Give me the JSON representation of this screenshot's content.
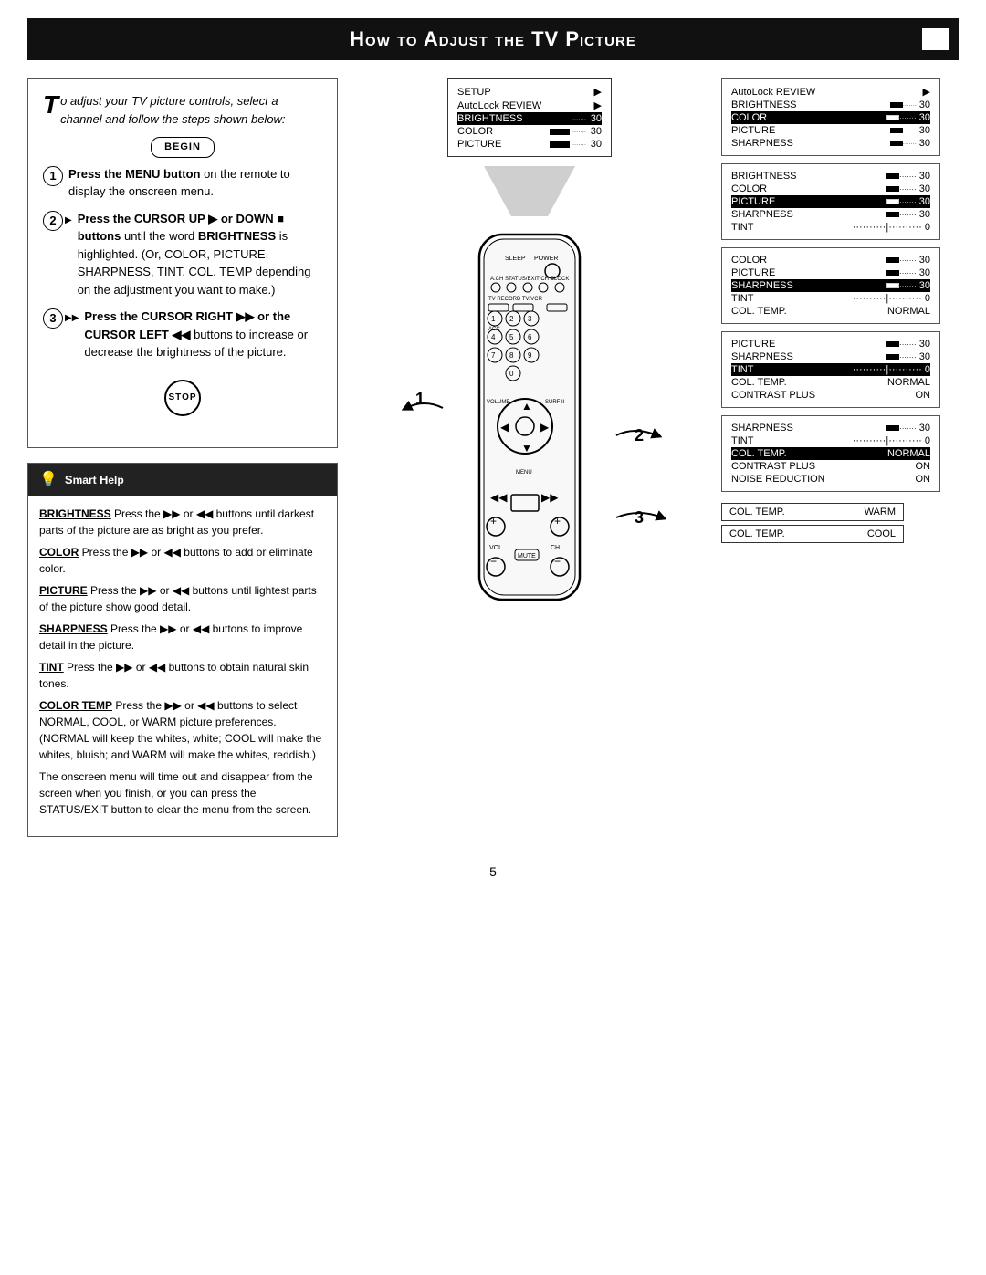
{
  "title": "How to Adjust the TV Picture",
  "intro": {
    "drop_cap": "T",
    "text": "o adjust your TV picture controls, select a channel and follow the steps shown below:"
  },
  "begin_label": "BEGIN",
  "stop_label": "STOP",
  "steps": [
    {
      "num": "1",
      "text_bold": "Press the MENU button",
      "text": " on the remote to display the onscreen menu."
    },
    {
      "num": "2",
      "text_bold": "Press the CURSOR UP ▶ or DOWN ■ buttons",
      "text": " until the word BRIGHTNESS is highlighted. (Or, COLOR, PICTURE, SHARPNESS, TINT, COL. TEMP depending on the adjustment you want to make.)"
    },
    {
      "num": "3",
      "text_bold": "Press the CURSOR RIGHT ▶▶ or the CURSOR LEFT ◀◀",
      "text": " buttons to increase or decrease the brightness of the picture."
    }
  ],
  "smart_help": {
    "title": "Smart Help",
    "items": [
      {
        "label": "BRIGHTNESS",
        "text": " Press the ▶▶ or ◀◀ buttons until darkest parts of the picture are as bright as you prefer."
      },
      {
        "label": "COLOR",
        "text": " Press the ▶▶ or ◀◀ buttons to add or eliminate color."
      },
      {
        "label": "PICTURE",
        "text": " Press the ▶▶ or ◀◀ buttons until lightest parts of the picture show good detail."
      },
      {
        "label": "SHARPNESS",
        "text": " Press the ▶▶ or ◀◀ buttons to improve detail in the picture."
      },
      {
        "label": "TINT",
        "text": " Press the ▶▶ or ◀◀ buttons to obtain natural skin tones."
      },
      {
        "label": "COLOR TEMP",
        "text": " Press the ▶▶ or ◀◀ buttons to select NORMAL, COOL, or WARM picture preferences. (NORMAL will keep the whites, white; COOL will make the whites, bluish; and WARM will make the whites, reddish.)"
      }
    ],
    "outro": "The onscreen menu will time out and disappear from the screen when you finish, or you can press the STATUS/EXIT button to clear the menu from the screen."
  },
  "menu_panel_top": {
    "items": [
      {
        "label": "SETUP",
        "type": "arrow"
      },
      {
        "label": "AutoLock REVIEW",
        "type": "arrow"
      },
      {
        "label": "BRIGHTNESS",
        "value": "30",
        "type": "bar",
        "highlighted": true
      },
      {
        "label": "COLOR",
        "value": "30",
        "type": "bar"
      },
      {
        "label": "PICTURE",
        "value": "30",
        "type": "bar"
      }
    ]
  },
  "right_panels": [
    {
      "items": [
        {
          "label": "AutoLock REVIEW",
          "type": "arrow"
        },
        {
          "label": "BRIGHTNESS",
          "value": "30",
          "type": "bar"
        },
        {
          "label": "COLOR",
          "value": "30",
          "type": "bar",
          "highlighted": true
        },
        {
          "label": "PICTURE",
          "value": "30",
          "type": "bar"
        },
        {
          "label": "SHARPNESS",
          "value": "30",
          "type": "bar"
        }
      ]
    },
    {
      "items": [
        {
          "label": "BRIGHTNESS",
          "value": "30",
          "type": "bar"
        },
        {
          "label": "COLOR",
          "value": "30",
          "type": "bar"
        },
        {
          "label": "PICTURE",
          "value": "30",
          "type": "bar",
          "highlighted": true
        },
        {
          "label": "SHARPNESS",
          "value": "30",
          "type": "bar"
        },
        {
          "label": "TINT",
          "value": "0",
          "type": "tint"
        }
      ]
    },
    {
      "items": [
        {
          "label": "COLOR",
          "value": "30",
          "type": "bar"
        },
        {
          "label": "PICTURE",
          "value": "30",
          "type": "bar"
        },
        {
          "label": "SHARPNESS",
          "value": "30",
          "type": "bar",
          "highlighted": true
        },
        {
          "label": "TINT",
          "value": "0",
          "type": "tint"
        },
        {
          "label": "COL. TEMP.",
          "value": "NORMAL",
          "type": "text"
        }
      ]
    },
    {
      "items": [
        {
          "label": "PICTURE",
          "value": "30",
          "type": "bar"
        },
        {
          "label": "SHARPNESS",
          "value": "30",
          "type": "bar"
        },
        {
          "label": "TINT",
          "value": "0",
          "type": "tint",
          "highlighted": true
        },
        {
          "label": "COL. TEMP.",
          "value": "NORMAL",
          "type": "text"
        },
        {
          "label": "CONTRAST PLUS",
          "value": "ON",
          "type": "text"
        }
      ]
    },
    {
      "items": [
        {
          "label": "SHARPNESS",
          "value": "30",
          "type": "bar"
        },
        {
          "label": "TINT",
          "value": "0",
          "type": "tint"
        },
        {
          "label": "COL. TEMP.",
          "value": "NORMAL",
          "type": "text",
          "highlighted": true
        },
        {
          "label": "CONTRAST PLUS",
          "value": "ON",
          "type": "text"
        },
        {
          "label": "NOISE REDUCTION",
          "value": "ON",
          "type": "text"
        }
      ]
    },
    {
      "items": [
        {
          "label": "COL. TEMP.",
          "value": "WARM",
          "type": "text",
          "highlighted": false,
          "bordered": true
        },
        {
          "label": "COL. TEMP.",
          "value": "COOL",
          "type": "text",
          "bordered": true
        }
      ]
    }
  ],
  "page_number": "5",
  "temp_warm_label": "TEMP WARM",
  "color_label": "COLOR"
}
